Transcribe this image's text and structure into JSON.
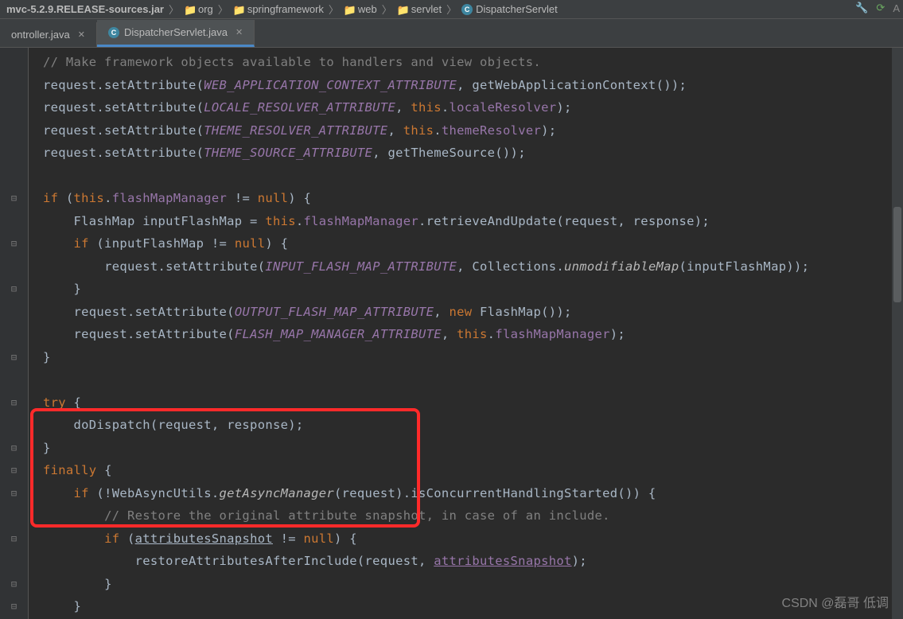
{
  "breadcrumbs": {
    "item0": "mvc-5.2.9.RELEASE-sources.jar",
    "item1": "org",
    "item2": "springframework",
    "item3": "web",
    "item4": "servlet",
    "item5": "DispatcherServlet"
  },
  "tabs": {
    "tab0": {
      "label": "ontroller.java"
    },
    "tab1": {
      "label": "DispatcherServlet.java"
    }
  },
  "toolbar": {
    "a_label": "A"
  },
  "code": {
    "c1": "// Make framework objects available to handlers and view objects.",
    "l2_a": "request.setAttribute(",
    "l2_b": "WEB_APPLICATION_CONTEXT_ATTRIBUTE",
    "l2_c": ", getWebApplicationContext());",
    "l3_a": "request.setAttribute(",
    "l3_b": "LOCALE_RESOLVER_ATTRIBUTE",
    "l3_c": ", ",
    "l3_d": "this",
    "l3_e": ".",
    "l3_f": "localeResolver",
    "l3_g": ");",
    "l4_a": "request.setAttribute(",
    "l4_b": "THEME_RESOLVER_ATTRIBUTE",
    "l4_c": ", ",
    "l4_d": "this",
    "l4_e": ".",
    "l4_f": "themeResolver",
    "l4_g": ");",
    "l5_a": "request.setAttribute(",
    "l5_b": "THEME_SOURCE_ATTRIBUTE",
    "l5_c": ", getThemeSource());",
    "l7_a": "if",
    "l7_b": " (",
    "l7_c": "this",
    "l7_d": ".",
    "l7_e": "flashMapManager",
    "l7_f": " != ",
    "l7_g": "null",
    "l7_h": ") {",
    "l8_a": "FlashMap inputFlashMap = ",
    "l8_b": "this",
    "l8_c": ".",
    "l8_d": "flashMapManager",
    "l8_e": ".retrieveAndUpdate(request, response);",
    "l9_a": "if",
    "l9_b": " (inputFlashMap != ",
    "l9_c": "null",
    "l9_d": ") {",
    "l10_a": "request.setAttribute(",
    "l10_b": "INPUT_FLASH_MAP_ATTRIBUTE",
    "l10_c": ", Collections.",
    "l10_d": "unmodifiableMap",
    "l10_e": "(inputFlashMap));",
    "l11": "}",
    "l12_a": "request.setAttribute(",
    "l12_b": "OUTPUT_FLASH_MAP_ATTRIBUTE",
    "l12_c": ", ",
    "l12_d": "new",
    "l12_e": " FlashMap());",
    "l13_a": "request.setAttribute(",
    "l13_b": "FLASH_MAP_MANAGER_ATTRIBUTE",
    "l13_c": ", ",
    "l13_d": "this",
    "l13_e": ".",
    "l13_f": "flashMapManager",
    "l13_g": ");",
    "l14": "}",
    "l16_a": "try",
    "l16_b": " {",
    "l17_a": "doDispatch(request, response);",
    "l18": "}",
    "l19_a": "finally",
    "l19_b": " {",
    "l20_a": "if",
    "l20_b": " (!WebAsyncUtils.",
    "l20_c": "getAsyncManager",
    "l20_d": "(request).isConcurrentHandlingStarted()) {",
    "l21": "// Restore the original attribute snapshot, in case of an include.",
    "l22_a": "if",
    "l22_b": " (",
    "l22_c": "attributesSnapshot",
    "l22_d": " != ",
    "l22_e": "null",
    "l22_f": ") {",
    "l23_a": "restoreAttributesAfterInclude(request, ",
    "l23_b": "attributesSnapshot",
    "l23_c": ");",
    "l24": "}",
    "l25": "}"
  },
  "watermark": "CSDN @磊哥 低调"
}
